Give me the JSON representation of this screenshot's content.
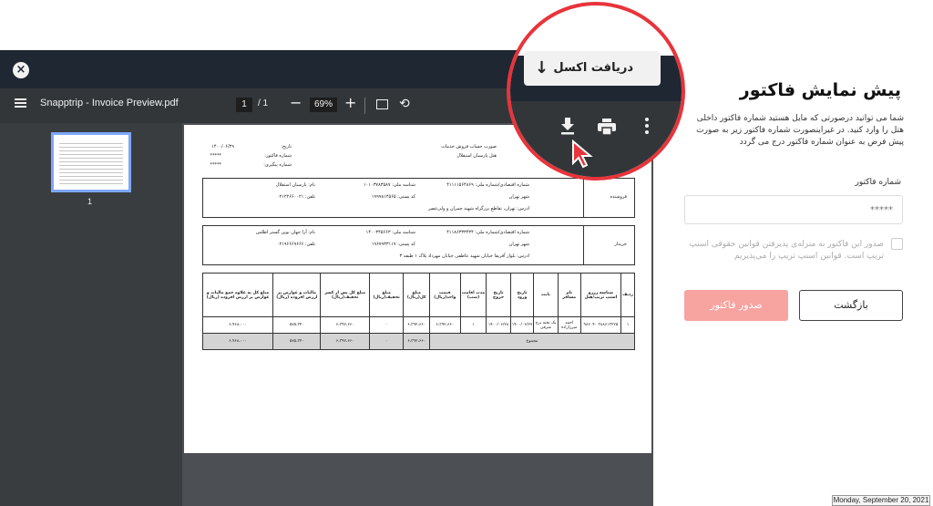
{
  "viewer": {
    "doc_title": "Snapptrip - Invoice Preview.pdf",
    "page_current": "1",
    "page_total": "/ 1",
    "zoom_minus": "−",
    "zoom": "69%",
    "zoom_plus": "+",
    "close_symbol": "×",
    "rotate_symbol": "⟲",
    "thumb_number": "1"
  },
  "invoice": {
    "header_lines": [
      "صورت حساب فروش خدمات",
      "هتل پارسیان استقلال"
    ],
    "meta_labels": [
      "تاریخ:",
      "شماره فاکتور:",
      "شماره پیگیری:"
    ],
    "meta_values": [
      "۱۴۰۰/۰۶/۲۹",
      "*****",
      "*****"
    ],
    "seller": {
      "label": "فروشنده",
      "economic_code": "شماره اقتصادی/شماره ملی: ۴۱۱۱۱۵۶۴۸۶۹",
      "national_id": "شناسه ملی: ۱۰۱۰۳۷۸۳۵۸۷",
      "name": "نام: پارسیان استقلال",
      "city": "شهر تهران",
      "postal": "کد پستی: ۱۹۹۹۸۱۴۵۶۵",
      "phone": "تلفن: ۰۲۱۲۲۶۶۰۰۲۱",
      "address": "ادرس: تهران، تقاطع بزرگراه شهید چمران و ولی‌عصر"
    },
    "buyer": {
      "label": "خریدار",
      "economic_code": "شماره اقتصادی/شماره ملی: ۴۱۱۸۶۳۳۳۴۳۴",
      "national_id": "شناسه ملی: ۱۴۰۰۳۴۵۶۶۳",
      "name": "نام: آرا جهان نوین گستر اطلس",
      "city": "شهر تهران",
      "postal": "کد پستی: ۱۹۶۷۹۳۳۱۱۷",
      "phone": "تلفن: ۰۲۱۹۶۶۶۹۶۶۶",
      "address": "ادرس: بلوار آفریقا خیابان شهید عاطفی خیابان مهرداد پلاک ۱ طبقه ۳"
    },
    "columns": [
      "ردیف",
      "شناسه رزرو اسنپ تریپ/هتل",
      "نام مسافر",
      "بابت",
      "تاریخ ورود",
      "تاریخ خروج",
      "مدت اقامت (شب)",
      "قیمت واحد(ریال)",
      "مبلغ کل(ریال)",
      "مبلغ تخفیف(ریال)",
      "مبلغ کل پس از کسر تخفیف(ریال)",
      "مالیات و عوارض بر ارزش افزوده (ریال)",
      "مبلغ کل به علاوه جمع مالیات و عوارض بر ارزش افزوده (ریال)"
    ],
    "row": [
      "۱",
      "۳۸۸۶۱۳۲۲۵ ۹۸۶۰۴۰",
      "احمد میرزازاده",
      "یک تخته برج شرقی",
      "۱۴۰۰/۰۶/۲۷",
      "۱۴۰۰/۰۶/۲۸",
      "۱",
      "۶،۳۹۲،۶۶۰",
      "۶،۳۹۲،۶۶۰",
      "۰",
      "۶،۳۹۲،۶۶۰",
      "۵۷۵،۳۴۰",
      "۶،۹۶۸،۰۰۰"
    ],
    "total_label": "مجموع",
    "total_values": [
      "۶،۳۹۲،۶۶۰",
      "۰",
      "۶،۳۹۲،۶۶۰",
      "۵۷۵،۳۴۰",
      "۶،۹۶۸،۰۰۰"
    ]
  },
  "panel": {
    "title": "پیش نمایش فاکتور",
    "description": "شما می توانید درصورتی که مایل هستید شماره فاکتور داخلی هتل را وارد کنید. در غیراینصورت شماره فاکتور زیر به صورت پیش فرض به عنوان شماره فاکتور درج می گردد",
    "invoice_number_label": "شماره فاکتور",
    "invoice_number_placeholder": "*****",
    "consent_text": "صدور این فاکتور به منزله‌ی پذیرفتن قوانین حقوقی اسنپ تریپ است. قوانین اسنپ تریپ را می‌پذیریم",
    "back_label": "بازگشت",
    "issue_label": "صدور فاکتور"
  },
  "callout": {
    "excel_label": "دریافت اکسل",
    "arrow_symbol": "↓",
    "ring_color": "#e8343a",
    "cursor_color": "#e8343a"
  },
  "date_stamp": "Monday, September 20, 2021",
  "colors": {
    "topbar": "#1f2733",
    "toolbar": "#323639",
    "viewer_bg": "#4c4f53",
    "issue_button": "#f7a39f",
    "thumb_border": "#7ea8f8"
  }
}
